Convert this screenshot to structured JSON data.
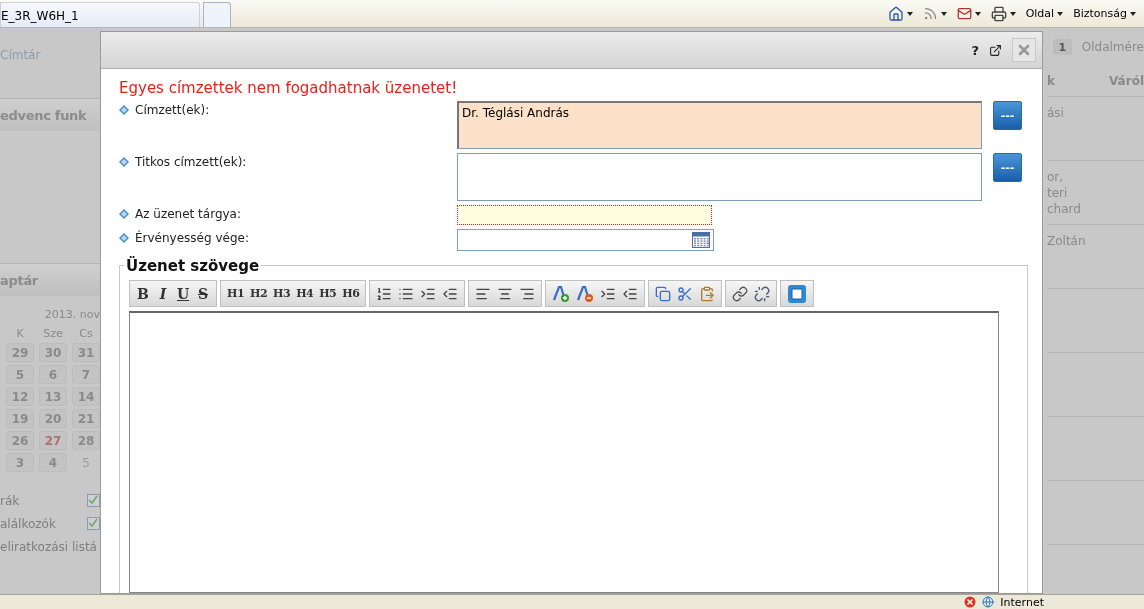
{
  "browser": {
    "tabs": [
      {
        "label": "E_3R_W6H_1",
        "selected": true
      },
      {
        "selected": false
      }
    ],
    "commands": [
      {
        "kind": "home"
      },
      {
        "kind": "feeds"
      },
      {
        "kind": "mail"
      },
      {
        "kind": "print"
      },
      {
        "kind": "menu",
        "label": "Oldal"
      },
      {
        "kind": "menu",
        "label": "Biztonság"
      }
    ]
  },
  "background_left": {
    "link": "Címtár",
    "favorites_title": "edvenc funk",
    "calendar_title": "aptár",
    "month": "2013. nov",
    "weekdays": [
      "K",
      "Sze",
      "Cs"
    ],
    "weeks": [
      [
        {
          "day": "29",
          "today": false,
          "muted": false
        },
        {
          "day": "30",
          "today": false,
          "muted": false
        },
        {
          "day": "31",
          "today": false,
          "muted": false
        }
      ],
      [
        {
          "day": "5",
          "today": false,
          "muted": false
        },
        {
          "day": "6",
          "today": false,
          "muted": false
        },
        {
          "day": "7",
          "today": false,
          "muted": false
        }
      ],
      [
        {
          "day": "12",
          "today": false,
          "muted": false
        },
        {
          "day": "13",
          "today": false,
          "muted": false
        },
        {
          "day": "14",
          "today": false,
          "muted": false
        }
      ],
      [
        {
          "day": "19",
          "today": false,
          "muted": false
        },
        {
          "day": "20",
          "today": false,
          "muted": false
        },
        {
          "day": "21",
          "today": false,
          "muted": false
        }
      ],
      [
        {
          "day": "26",
          "today": false,
          "muted": false
        },
        {
          "day": "27",
          "today": true,
          "muted": false
        },
        {
          "day": "28",
          "today": false,
          "muted": false
        }
      ],
      [
        {
          "day": "3",
          "today": false,
          "muted": false
        },
        {
          "day": "4",
          "today": false,
          "muted": false
        },
        {
          "day": "5",
          "today": false,
          "muted": true
        }
      ]
    ],
    "filters": [
      {
        "label": "rák",
        "checked": true
      },
      {
        "label": "alálkozók",
        "checked": true
      },
      {
        "label": "eliratkozási listá"
      }
    ]
  },
  "background_right": {
    "page": "1",
    "page_size_label": "Oldalmére",
    "columns": [
      "k",
      "Váról"
    ],
    "rows": [
      {
        "lines": [
          "ási"
        ]
      },
      {
        "lines": [
          "or,",
          "teri",
          "chard"
        ]
      },
      {
        "lines": [
          "Zoltán"
        ]
      },
      {
        "lines": []
      },
      {
        "lines": []
      },
      {
        "lines": []
      },
      {
        "lines": []
      }
    ]
  },
  "dialog": {
    "help": "?",
    "error": "Egyes címzettek nem fogadhatnak üzenetet!",
    "fields": [
      {
        "kind": "multiline",
        "label": "Címzett(ek):",
        "value": "Dr. Téglási András",
        "invalid": true,
        "required": false,
        "picker": "---"
      },
      {
        "kind": "multiline",
        "label": "Titkos címzett(ek):",
        "invalid": false,
        "required": false,
        "picker": "---"
      },
      {
        "kind": "text",
        "label": "Az üzenet tárgya:",
        "invalid": false,
        "required": true
      },
      {
        "kind": "date",
        "label": "Érvényesség vége:",
        "invalid": false,
        "required": false
      }
    ],
    "editor": {
      "legend": "Üzenet szövege",
      "format_buttons": [
        {
          "label": "B",
          "kind": "bold"
        },
        {
          "label": "I",
          "kind": "italic"
        },
        {
          "label": "U",
          "kind": "underline"
        },
        {
          "label": "S",
          "kind": "strike"
        }
      ],
      "heading_buttons": [
        "H1",
        "H2",
        "H3",
        "H4",
        "H5",
        "H6"
      ]
    }
  },
  "status_bar": {
    "zone": "Internet"
  }
}
